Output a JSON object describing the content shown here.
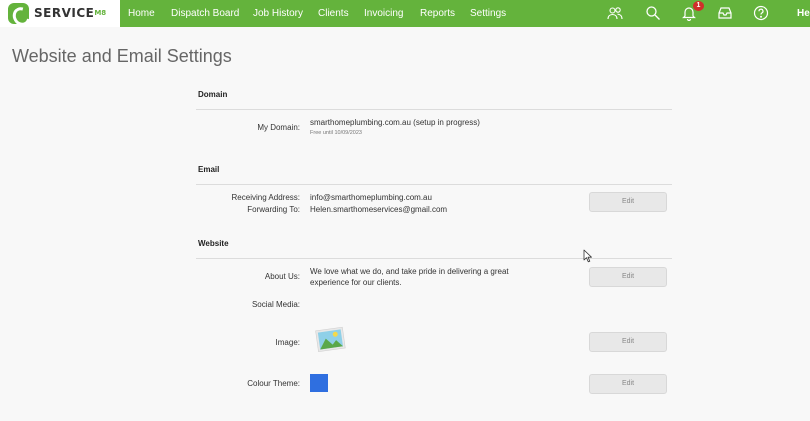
{
  "app": {
    "logo_text": "SERVICE",
    "logo_suffix": "M8"
  },
  "nav": {
    "items": [
      {
        "label": "Home"
      },
      {
        "label": "Dispatch Board"
      },
      {
        "label": "Job History"
      },
      {
        "label": "Clients"
      },
      {
        "label": "Invoicing"
      },
      {
        "label": "Reports"
      },
      {
        "label": "Settings"
      }
    ],
    "notification_count": "1",
    "cut_off_text": "He",
    "icons": [
      "users-icon",
      "search-icon",
      "bell-icon",
      "inbox-icon",
      "help-icon"
    ]
  },
  "page": {
    "title": "Website and Email Settings"
  },
  "domain": {
    "heading": "Domain",
    "my_domain_label": "My Domain:",
    "my_domain_value": "smarthomeplumbing.com.au (setup in progress)",
    "my_domain_note": "Free until 10/09/2023"
  },
  "email": {
    "heading": "Email",
    "receiving_label": "Receiving Address:",
    "receiving_value": "info@smarthomeplumbing.com.au",
    "forwarding_label": "Forwarding To:",
    "forwarding_value": "Helen.smarthomeservices@gmail.com",
    "edit_label": "Edit"
  },
  "website": {
    "heading": "Website",
    "about_label": "About Us:",
    "about_value": "We love what we do, and take pride in delivering a great experience for our clients.",
    "about_edit_label": "Edit",
    "social_label": "Social Media:",
    "image_label": "Image:",
    "image_edit_label": "Edit",
    "colour_label": "Colour Theme:",
    "colour_value": "#2f6fe0",
    "colour_edit_label": "Edit"
  },
  "colors": {
    "brand_green": "#64b33c",
    "badge_red": "#d0302a"
  }
}
